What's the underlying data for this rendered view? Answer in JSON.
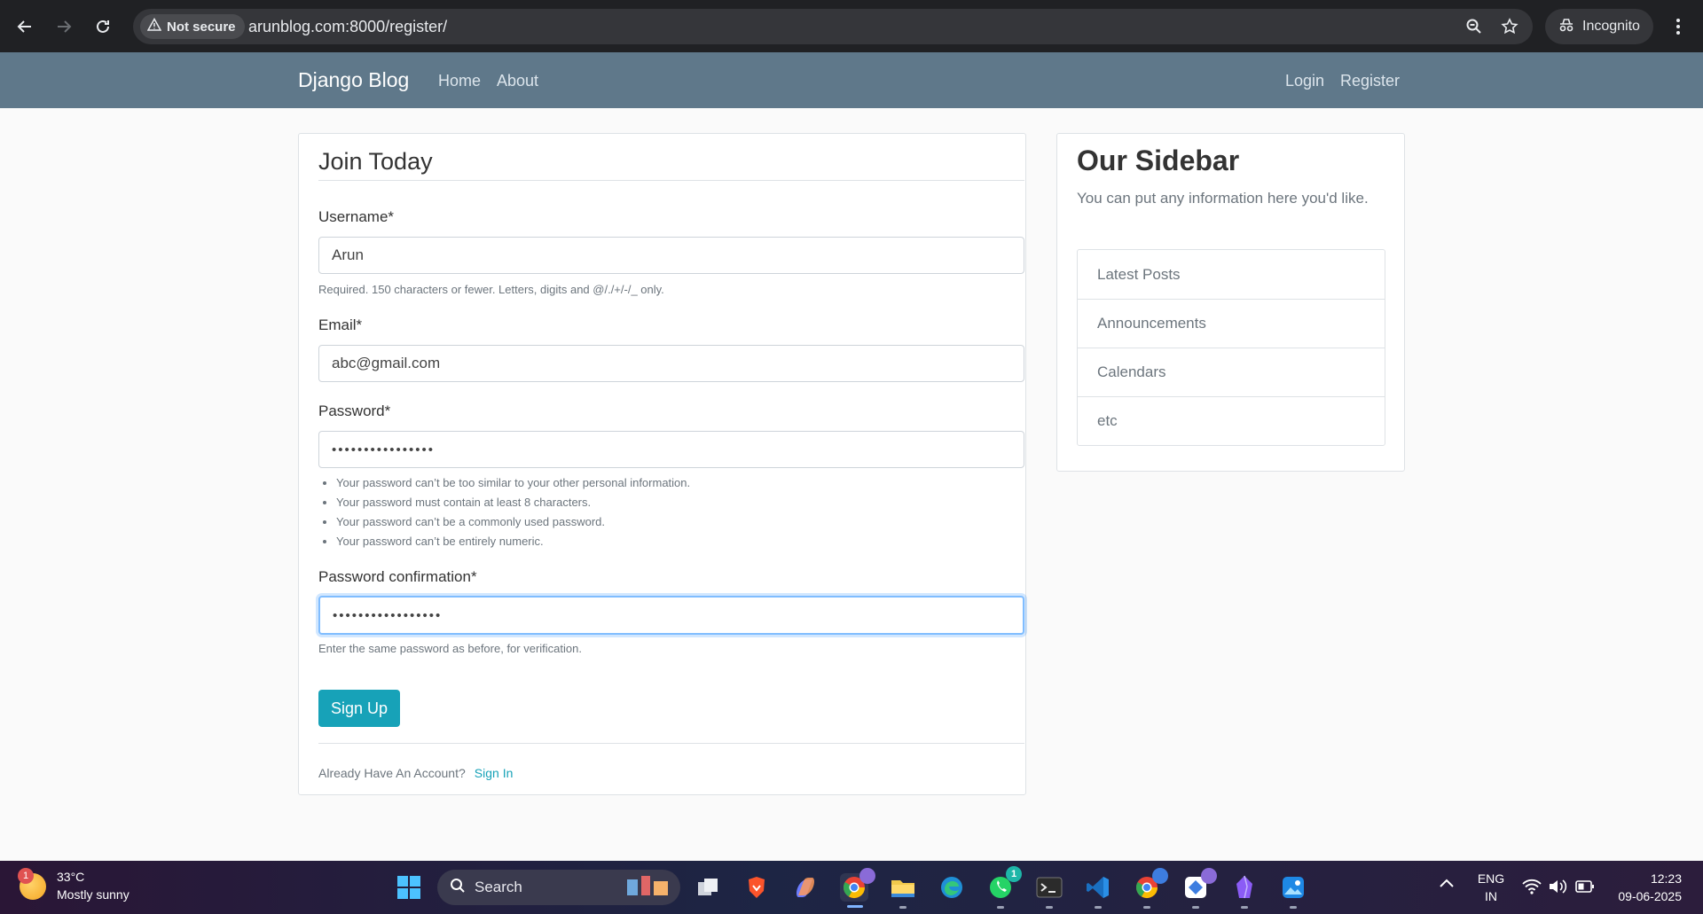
{
  "browser": {
    "security_label": "Not secure",
    "url": "arunblog.com:8000/register/",
    "incognito_label": "Incognito"
  },
  "site_nav": {
    "brand": "Django Blog",
    "links": [
      "Home",
      "About"
    ],
    "auth_links": [
      "Login",
      "Register"
    ],
    "bg_color": "#5f788a"
  },
  "form": {
    "legend": "Join Today",
    "username": {
      "label": "Username*",
      "value": "Arun",
      "help": "Required. 150 characters or fewer. Letters, digits and @/./+/-/_ only."
    },
    "email": {
      "label": "Email*",
      "value": "abc@gmail.com"
    },
    "password": {
      "label": "Password*",
      "value_masked": "••••••••••••••••",
      "help_items": [
        "Your password can’t be too similar to your other personal information.",
        "Your password must contain at least 8 characters.",
        "Your password can’t be a commonly used password.",
        "Your password can’t be entirely numeric."
      ]
    },
    "password_confirmation": {
      "label": "Password confirmation*",
      "value_masked": "•••••••••••••••••",
      "help": "Enter the same password as before, for verification."
    },
    "submit_label": "Sign Up",
    "footer_text": "Already Have An Account?",
    "footer_link": "Sign In",
    "accent_color": "#17a2b8"
  },
  "sidebar": {
    "title": "Our Sidebar",
    "text": "You can put any information here you'd like.",
    "items": [
      "Latest Posts",
      "Announcements",
      "Calendars",
      "etc"
    ]
  },
  "taskbar": {
    "weather_temp": "33°C",
    "weather_desc": "Mostly sunny",
    "weather_badge": "1",
    "search_label": "Search",
    "whatsapp_badge": "1",
    "lang_top": "ENG",
    "lang_bottom": "IN",
    "time": "12:23",
    "date": "09-06-2025",
    "apps": [
      "windows-start",
      "widgets",
      "task-view",
      "brave",
      "copilot",
      "chrome",
      "file-explorer",
      "edge",
      "whatsapp",
      "terminal",
      "vscode",
      "chrome-profile",
      "extension-app",
      "obsidian",
      "photos"
    ]
  }
}
